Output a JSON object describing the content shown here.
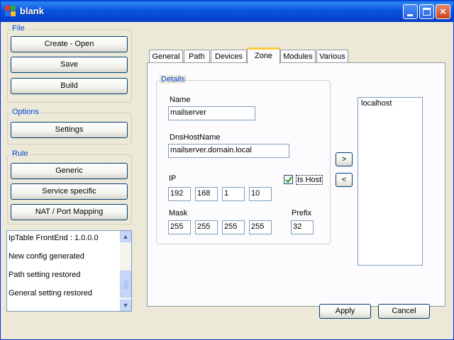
{
  "window": {
    "title": "blank"
  },
  "file_group": {
    "label": "File",
    "buttons": [
      "Create - Open",
      "Save",
      "Build"
    ]
  },
  "options_group": {
    "label": "Options",
    "buttons": [
      "Settings"
    ]
  },
  "rule_group": {
    "label": "Rule",
    "buttons": [
      "Generic",
      "Service specific",
      "NAT / Port Mapping"
    ]
  },
  "log": {
    "lines": [
      "IpTable FrontEnd : 1.0.0.0",
      "New config generated",
      "Path setting restored",
      "General setting restored"
    ]
  },
  "tabs": [
    "General",
    "Path",
    "Devices",
    "Zone",
    "Modules",
    "Various"
  ],
  "active_tab": "Zone",
  "details": {
    "label": "Details",
    "name_label": "Name",
    "name_value": "mailserver",
    "dns_label": "DnsHostName",
    "dns_value": "mailserver.domain.local",
    "ip_label": "IP",
    "ip": [
      "192",
      "168",
      "1",
      "10"
    ],
    "is_host_label": "Is Host",
    "is_host_checked": true,
    "mask_label": "Mask",
    "mask": [
      "255",
      "255",
      "255",
      "255"
    ],
    "prefix_label": "Prefix",
    "prefix_value": "32"
  },
  "move_buttons": {
    "add": ">",
    "remove": "<"
  },
  "hosts_list": [
    "localhost"
  ],
  "actions": {
    "apply": "Apply",
    "cancel": "Cancel"
  },
  "colors": {
    "title_bar": "#0a56e0",
    "group_label": "#0046d5",
    "tab_highlight": "#ffc83c",
    "dialog_bg": "#ece9d8"
  }
}
